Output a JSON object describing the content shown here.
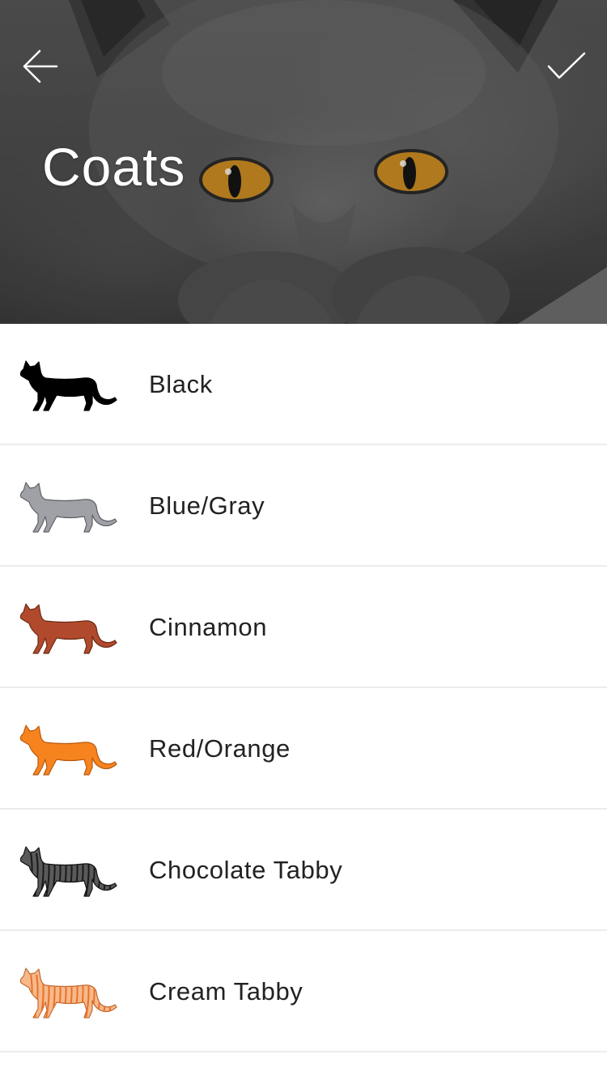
{
  "header": {
    "title": "Coats",
    "back_icon": "arrow-left-icon",
    "done_icon": "checkmark-icon"
  },
  "coats": [
    {
      "label": "Black",
      "icon": "cat-black-icon",
      "fill": "#000000",
      "stroke": "#000000",
      "pattern": "solid"
    },
    {
      "label": "Blue/Gray",
      "icon": "cat-blue-gray-icon",
      "fill": "#9fa1a6",
      "stroke": "#5f6166",
      "pattern": "solid"
    },
    {
      "label": "Cinnamon",
      "icon": "cat-cinnamon-icon",
      "fill": "#b14a2d",
      "stroke": "#6e2a16",
      "pattern": "solid"
    },
    {
      "label": "Red/Orange",
      "icon": "cat-red-orange-icon",
      "fill": "#f7831f",
      "stroke": "#b85a0c",
      "pattern": "solid"
    },
    {
      "label": "Chocolate Tabby",
      "icon": "cat-chocolate-tabby-icon",
      "fill": "#5a5a5a",
      "stroke": "#111111",
      "pattern": "tabby",
      "stripe": "#1a1a1a"
    },
    {
      "label": "Cream Tabby",
      "icon": "cat-cream-tabby-icon",
      "fill": "#f7b98a",
      "stroke": "#c06a32",
      "pattern": "tabby",
      "stripe": "#e8712a"
    }
  ]
}
